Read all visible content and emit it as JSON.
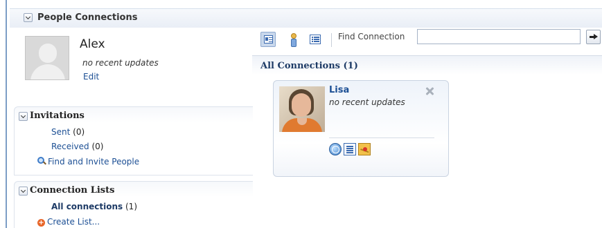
{
  "header": {
    "title": "People Connections"
  },
  "profile": {
    "name": "Alex",
    "status": "no recent updates",
    "edit_label": "Edit"
  },
  "invitations": {
    "title": "Invitations",
    "sent_label": "Sent",
    "sent_count": "(0)",
    "received_label": "Received",
    "received_count": "(0)",
    "find_invite_label": "Find and Invite People"
  },
  "connection_lists": {
    "title": "Connection Lists",
    "all_label": "All connections",
    "all_count": "(1)",
    "create_label": "Create List..."
  },
  "toolbar": {
    "find_label": "Find Connection",
    "find_value": "",
    "view_buttons": [
      "card-view-icon",
      "person-view-icon",
      "list-view-icon"
    ],
    "go_icon": "arrow-right-icon"
  },
  "connections": {
    "title": "All Connections",
    "count": "(1)",
    "items": [
      {
        "name": "Lisa",
        "status": "no recent updates",
        "actions": [
          "profile-globe-icon",
          "activity-doc-icon",
          "message-mail-icon"
        ]
      }
    ]
  },
  "colors": {
    "link": "#1c4f94",
    "accent": "#7c9dc6",
    "card_bg": "#eef3fa"
  }
}
